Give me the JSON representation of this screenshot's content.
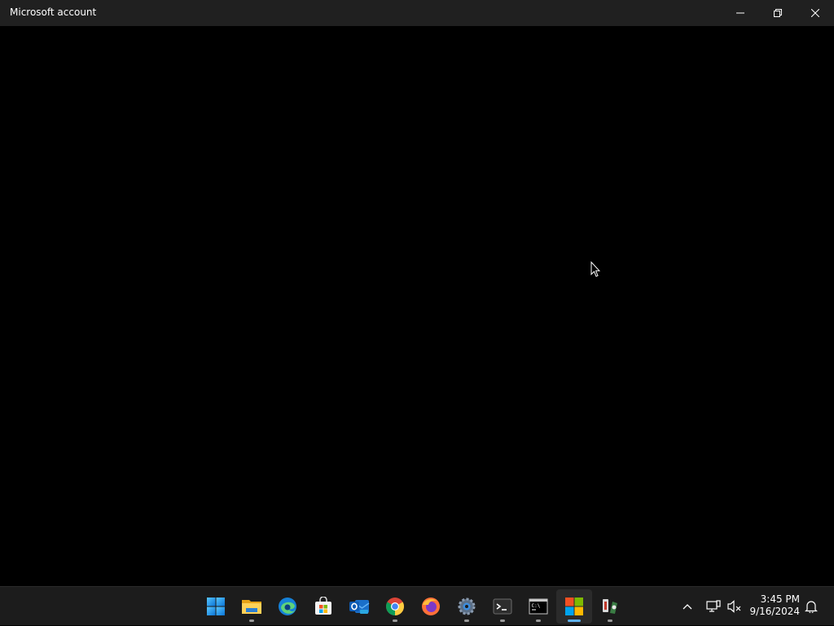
{
  "window": {
    "title": "Microsoft account",
    "controls": [
      "minimize",
      "restore",
      "close"
    ]
  },
  "taskbar": {
    "apps": [
      {
        "name": "Start",
        "icon": "windows-start-icon",
        "running": false
      },
      {
        "name": "File Explorer",
        "icon": "file-explorer-icon",
        "running": true
      },
      {
        "name": "Microsoft Edge",
        "icon": "edge-icon",
        "running": false
      },
      {
        "name": "Microsoft Store",
        "icon": "store-icon",
        "running": false
      },
      {
        "name": "Outlook (new)",
        "icon": "outlook-icon",
        "running": false
      },
      {
        "name": "Google Chrome",
        "icon": "chrome-icon",
        "running": true
      },
      {
        "name": "Firefox",
        "icon": "firefox-icon",
        "running": false
      },
      {
        "name": "Settings",
        "icon": "settings-icon",
        "running": true
      },
      {
        "name": "Terminal",
        "icon": "terminal-icon",
        "running": true
      },
      {
        "name": "Command Prompt",
        "icon": "cmd-icon",
        "running": true
      },
      {
        "name": "Microsoft account",
        "icon": "microsoft-logo-icon",
        "running": true,
        "active": true
      },
      {
        "name": "App",
        "icon": "app-icon",
        "running": true
      }
    ],
    "tray": {
      "icons": [
        "chevron-up-icon",
        "network-icon",
        "volume-muted-icon",
        "notification-bell-icon"
      ]
    },
    "clock": {
      "time": "3:45 PM",
      "date": "9/16/2024"
    }
  },
  "colors": {
    "titlebar": "#202020",
    "taskbar": "#1c1c1c",
    "content": "#000000",
    "active_indicator": "#5fb2f2"
  }
}
